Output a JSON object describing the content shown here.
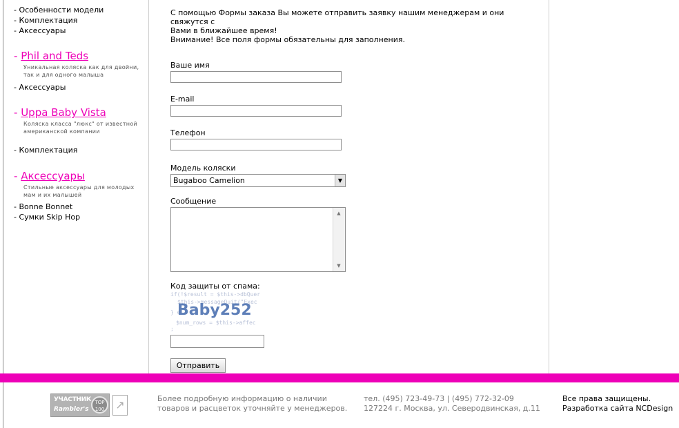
{
  "sidebar": {
    "top_links": [
      "- Особенности модели",
      "- Комплектация",
      "- Аксессуары"
    ],
    "sections": [
      {
        "title": "Phil and Teds",
        "description": "Уникальная коляска как для двойни, так и для одного малыша",
        "links": [
          "- Аксессуары"
        ]
      },
      {
        "title": "Uppa Baby Vista",
        "description": "Коляска класса \"люкс\" от известной американской компании",
        "links": [
          "- Комплектация"
        ]
      },
      {
        "title": "Аксессуары",
        "description": "Стильные аксессуары для молодых мам и их малышей",
        "links": [
          "- Bonne Bonnet",
          "- Сумки Skip Hop"
        ]
      }
    ]
  },
  "form": {
    "intro_line1": "С помощью Формы заказа Вы можете отправить заявку нашим менеджерам и они свяжутся с",
    "intro_line2": "Вами в ближайшее время!",
    "intro_line3": "Внимание! Все поля формы обязательны для заполнения.",
    "name_label": "Ваше имя",
    "name_value": "",
    "email_label": "E-mail",
    "email_value": "",
    "phone_label": "Телефон",
    "phone_value": "",
    "model_label": "Модель коляски",
    "model_selected": "Bugaboo Camelion",
    "message_label": "Сообщение",
    "message_value": "",
    "captcha_label": "Код защиты от спама:",
    "captcha_word": "Baby252",
    "captcha_code_lines": [
      "if(!$result = $this->dbQuer",
      "$this->messageQuit(\"Exec",
      "} el",
      "$num_rows = $this->affec",
      ";"
    ],
    "captcha_value": "",
    "submit_label": "Отправить"
  },
  "footer": {
    "badge_line1": "УЧАСТНИК",
    "badge_line2": "Rambler's",
    "badge_top": "TOP",
    "badge_num": "100",
    "info_line1": "Более подробную информацию о наличии",
    "info_line2": "товаров и расцветок уточняйте у менеджеров.",
    "phone_line": "тел. (495) 723-49-73 | (495) 772-32-09",
    "address_line": "127224 г. Москва, ул. Северодвинская, д.11",
    "rights_line1": "Все права защищены.",
    "rights_line2": "Разработка сайта NCDesign"
  },
  "colors": {
    "accent": "#ee00b8"
  }
}
